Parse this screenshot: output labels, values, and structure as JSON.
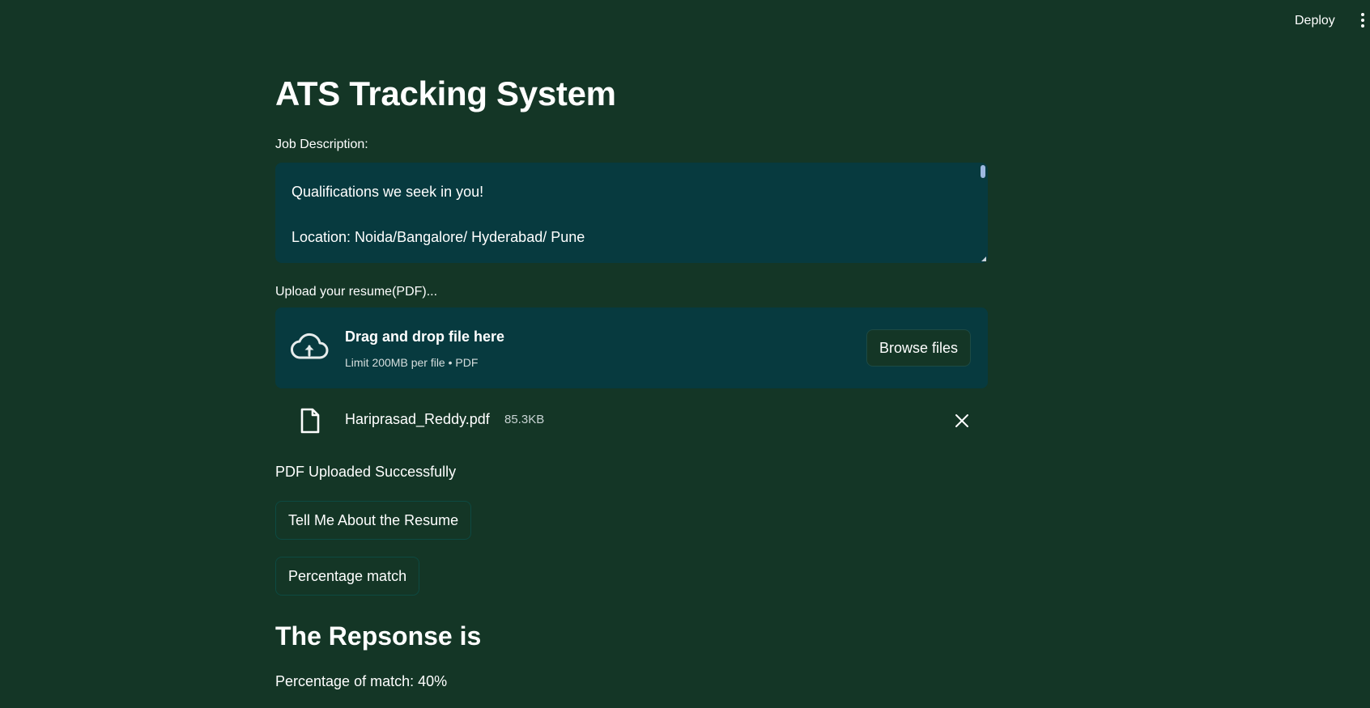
{
  "header": {
    "deploy_label": "Deploy"
  },
  "page": {
    "title": "ATS Tracking System"
  },
  "job_description": {
    "label": "Job Description:",
    "lines": [
      "Qualifications we seek in you!",
      "Location: Noida/Bangalore/ Hyderabad/ Pune"
    ]
  },
  "uploader": {
    "label": "Upload your resume(PDF)...",
    "drop_text": "Drag and drop file here",
    "limit_text": "Limit 200MB per file • PDF",
    "browse_label": "Browse files",
    "file": {
      "name": "Hariprasad_Reddy.pdf",
      "size": "85.3KB"
    }
  },
  "status": {
    "message": "PDF Uploaded Successfully"
  },
  "actions": {
    "tell_me_label": "Tell Me About the Resume",
    "percentage_label": "Percentage match"
  },
  "response": {
    "heading": "The Repsonse is",
    "text": "Percentage of match: 40%"
  },
  "icons": {
    "upload": "cloud-upload-icon",
    "file": "file-icon",
    "close": "close-icon",
    "menu": "more-vertical-icon"
  },
  "colors": {
    "background": "#143626",
    "panel": "#073a3f",
    "text": "#ffffff"
  }
}
